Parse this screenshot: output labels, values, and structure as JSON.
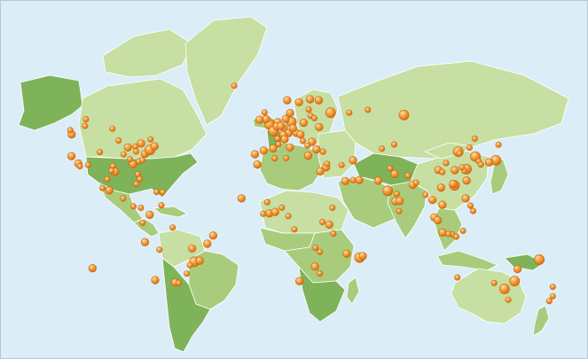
{
  "map": {
    "style": "world-mercator-choropleth",
    "colors": {
      "ocean": "#dbeef7",
      "land_light": "#c7dfa2",
      "land_mid": "#a8cc7c",
      "land_dark": "#7fb35a",
      "border": "#ffffff",
      "marker_fill": "#f29a2e",
      "marker_highlight": "#fde0b5",
      "marker_stroke": "#c8620f"
    },
    "regions": [
      {
        "id": "alaska",
        "shade": "land_dark"
      },
      {
        "id": "canada",
        "shade": "land_light"
      },
      {
        "id": "arctic-islands",
        "shade": "land_light"
      },
      {
        "id": "usa",
        "shade": "land_dark"
      },
      {
        "id": "mexico",
        "shade": "land_mid"
      },
      {
        "id": "central-america",
        "shade": "land_mid"
      },
      {
        "id": "caribbean",
        "shade": "land_mid"
      },
      {
        "id": "greenland",
        "shade": "land_light"
      },
      {
        "id": "iceland",
        "shade": "land_mid"
      },
      {
        "id": "south-america-north",
        "shade": "land_light"
      },
      {
        "id": "brazil",
        "shade": "land_mid"
      },
      {
        "id": "south-america-south",
        "shade": "land_dark"
      },
      {
        "id": "europe-west",
        "shade": "land_mid"
      },
      {
        "id": "uk",
        "shade": "land_dark"
      },
      {
        "id": "scandinavia",
        "shade": "land_light"
      },
      {
        "id": "eastern-europe",
        "shade": "land_light"
      },
      {
        "id": "russia",
        "shade": "land_light"
      },
      {
        "id": "north-africa",
        "shade": "land_light"
      },
      {
        "id": "west-africa",
        "shade": "land_mid"
      },
      {
        "id": "central-africa",
        "shade": "land_mid"
      },
      {
        "id": "southern-africa",
        "shade": "land_dark"
      },
      {
        "id": "madagascar",
        "shade": "land_mid"
      },
      {
        "id": "middle-east",
        "shade": "land_mid"
      },
      {
        "id": "central-asia",
        "shade": "land_dark"
      },
      {
        "id": "india",
        "shade": "land_mid"
      },
      {
        "id": "china",
        "shade": "land_light"
      },
      {
        "id": "mongolia",
        "shade": "land_light"
      },
      {
        "id": "southeast-asia",
        "shade": "land_mid"
      },
      {
        "id": "japan",
        "shade": "land_mid"
      },
      {
        "id": "indonesia",
        "shade": "land_mid"
      },
      {
        "id": "new-guinea",
        "shade": "land_dark"
      },
      {
        "id": "australia",
        "shade": "land_light"
      },
      {
        "id": "new-zealand",
        "shade": "land_mid"
      }
    ],
    "markers": [
      {
        "lon": -122.4,
        "lat": 37.8,
        "size": 2
      },
      {
        "lon": -118.2,
        "lat": 34.1,
        "size": 2
      },
      {
        "lon": -122.3,
        "lat": 47.6,
        "size": 2
      },
      {
        "lon": -117.2,
        "lat": 32.7,
        "size": 1
      },
      {
        "lon": -112.1,
        "lat": 33.4,
        "size": 1
      },
      {
        "lon": -104.9,
        "lat": 39.7,
        "size": 1
      },
      {
        "lon": -96.8,
        "lat": 32.8,
        "size": 1
      },
      {
        "lon": -95.4,
        "lat": 29.8,
        "size": 2
      },
      {
        "lon": -97.7,
        "lat": 30.3,
        "size": 1
      },
      {
        "lon": -93.3,
        "lat": 45.0,
        "size": 1
      },
      {
        "lon": -87.6,
        "lat": 41.9,
        "size": 2
      },
      {
        "lon": -90.2,
        "lat": 38.6,
        "size": 1
      },
      {
        "lon": -84.4,
        "lat": 33.7,
        "size": 2
      },
      {
        "lon": -81.4,
        "lat": 28.5,
        "size": 1
      },
      {
        "lon": -80.2,
        "lat": 25.8,
        "size": 1
      },
      {
        "lon": -77.0,
        "lat": 38.9,
        "size": 2
      },
      {
        "lon": -75.2,
        "lat": 40.0,
        "size": 1
      },
      {
        "lon": -74.0,
        "lat": 40.7,
        "size": 3
      },
      {
        "lon": -71.1,
        "lat": 42.4,
        "size": 2
      },
      {
        "lon": -79.4,
        "lat": 43.7,
        "size": 2
      },
      {
        "lon": -73.6,
        "lat": 45.5,
        "size": 1
      },
      {
        "lon": -83.0,
        "lat": 42.3,
        "size": 1
      },
      {
        "lon": -86.2,
        "lat": 36.2,
        "size": 1
      },
      {
        "lon": -80.8,
        "lat": 35.2,
        "size": 1
      },
      {
        "lon": -78.6,
        "lat": 35.8,
        "size": 1
      },
      {
        "lon": -82.5,
        "lat": 40.0,
        "size": 1
      },
      {
        "lon": -123.1,
        "lat": 49.3,
        "size": 1
      },
      {
        "lon": -114.1,
        "lat": 51.0,
        "size": 1
      },
      {
        "lon": -113.5,
        "lat": 53.5,
        "size": 1
      },
      {
        "lon": -97.1,
        "lat": 49.9,
        "size": 1
      },
      {
        "lon": -99.1,
        "lat": 19.4,
        "size": 2
      },
      {
        "lon": -103.3,
        "lat": 20.7,
        "size": 1
      },
      {
        "lon": -100.3,
        "lat": 25.7,
        "size": 1
      },
      {
        "lon": -90.5,
        "lat": 14.6,
        "size": 1
      },
      {
        "lon": -84.1,
        "lat": 9.9,
        "size": 1
      },
      {
        "lon": -79.5,
        "lat": 9.0,
        "size": 1
      },
      {
        "lon": -82.4,
        "lat": 23.1,
        "size": 1
      },
      {
        "lon": -66.1,
        "lat": 18.4,
        "size": 1
      },
      {
        "lon": -69.9,
        "lat": 18.5,
        "size": 1
      },
      {
        "lon": -74.1,
        "lat": 4.7,
        "size": 2
      },
      {
        "lon": -66.9,
        "lat": 10.5,
        "size": 1
      },
      {
        "lon": -78.5,
        "lat": -0.2,
        "size": 1
      },
      {
        "lon": -77.0,
        "lat": -12.0,
        "size": 2
      },
      {
        "lon": -68.1,
        "lat": -16.5,
        "size": 1
      },
      {
        "lon": -70.7,
        "lat": -33.4,
        "size": 2
      },
      {
        "lon": -58.4,
        "lat": -34.6,
        "size": 2
      },
      {
        "lon": -56.2,
        "lat": -34.9,
        "size": 1
      },
      {
        "lon": -46.6,
        "lat": -23.5,
        "size": 3
      },
      {
        "lon": -43.2,
        "lat": -22.9,
        "size": 2
      },
      {
        "lon": -47.9,
        "lat": -15.8,
        "size": 2
      },
      {
        "lon": -38.5,
        "lat": -13.0,
        "size": 2
      },
      {
        "lon": -34.9,
        "lat": -8.0,
        "size": 2
      },
      {
        "lon": -49.3,
        "lat": -25.4,
        "size": 1
      },
      {
        "lon": -51.2,
        "lat": -30.0,
        "size": 1
      },
      {
        "lon": -60.0,
        "lat": -3.1,
        "size": 1
      },
      {
        "lon": -109.4,
        "lat": -27.1,
        "size": 2
      },
      {
        "lon": -0.1,
        "lat": 51.5,
        "size": 3
      },
      {
        "lon": -2.2,
        "lat": 53.5,
        "size": 2
      },
      {
        "lon": -3.2,
        "lat": 55.9,
        "size": 1
      },
      {
        "lon": -6.3,
        "lat": 53.3,
        "size": 2
      },
      {
        "lon": 2.35,
        "lat": 48.9,
        "size": 3
      },
      {
        "lon": 4.9,
        "lat": 52.4,
        "size": 2
      },
      {
        "lon": 4.4,
        "lat": 50.8,
        "size": 2
      },
      {
        "lon": 8.7,
        "lat": 50.1,
        "size": 2
      },
      {
        "lon": 13.4,
        "lat": 52.5,
        "size": 3
      },
      {
        "lon": 11.6,
        "lat": 48.1,
        "size": 2
      },
      {
        "lon": 9.9,
        "lat": 53.6,
        "size": 2
      },
      {
        "lon": 6.9,
        "lat": 50.9,
        "size": 2
      },
      {
        "lon": 8.5,
        "lat": 47.4,
        "size": 2
      },
      {
        "lon": 16.4,
        "lat": 48.2,
        "size": 2
      },
      {
        "lon": 14.4,
        "lat": 50.1,
        "size": 2
      },
      {
        "lon": 21.0,
        "lat": 52.2,
        "size": 2
      },
      {
        "lon": 19.0,
        "lat": 47.5,
        "size": 2
      },
      {
        "lon": 12.5,
        "lat": 41.9,
        "size": 2
      },
      {
        "lon": 9.2,
        "lat": 45.5,
        "size": 2
      },
      {
        "lon": -3.7,
        "lat": 40.4,
        "size": 2
      },
      {
        "lon": 2.2,
        "lat": 41.4,
        "size": 2
      },
      {
        "lon": -9.1,
        "lat": 38.7,
        "size": 2
      },
      {
        "lon": 5.4,
        "lat": 43.3,
        "size": 1
      },
      {
        "lon": 4.8,
        "lat": 45.8,
        "size": 1
      },
      {
        "lon": 12.6,
        "lat": 55.7,
        "size": 2
      },
      {
        "lon": 18.1,
        "lat": 59.3,
        "size": 2
      },
      {
        "lon": 10.8,
        "lat": 59.9,
        "size": 2
      },
      {
        "lon": 24.9,
        "lat": 60.2,
        "size": 2
      },
      {
        "lon": 24.1,
        "lat": 56.9,
        "size": 1
      },
      {
        "lon": 25.3,
        "lat": 54.7,
        "size": 1
      },
      {
        "lon": 30.5,
        "lat": 50.5,
        "size": 2
      },
      {
        "lon": 26.1,
        "lat": 44.4,
        "size": 2
      },
      {
        "lon": 23.3,
        "lat": 42.7,
        "size": 1
      },
      {
        "lon": 20.5,
        "lat": 44.8,
        "size": 1
      },
      {
        "lon": 23.7,
        "lat": 38.0,
        "size": 2
      },
      {
        "lon": 28.9,
        "lat": 41.0,
        "size": 2
      },
      {
        "lon": 32.9,
        "lat": 39.9,
        "size": 1
      },
      {
        "lon": 37.6,
        "lat": 55.8,
        "size": 3
      },
      {
        "lon": 30.3,
        "lat": 59.9,
        "size": 2
      },
      {
        "lon": 27.6,
        "lat": 53.9,
        "size": 1
      },
      {
        "lon": 49.1,
        "lat": 55.8,
        "size": 1
      },
      {
        "lon": 60.6,
        "lat": 56.8,
        "size": 1
      },
      {
        "lon": 82.9,
        "lat": 55.0,
        "size": 3
      },
      {
        "lon": -21.9,
        "lat": 64.1,
        "size": 1
      },
      {
        "lon": 34.8,
        "lat": 32.1,
        "size": 2
      },
      {
        "lon": 35.5,
        "lat": 33.9,
        "size": 1
      },
      {
        "lon": 44.4,
        "lat": 33.3,
        "size": 1
      },
      {
        "lon": 46.7,
        "lat": 24.7,
        "size": 2
      },
      {
        "lon": 55.3,
        "lat": 25.3,
        "size": 2
      },
      {
        "lon": 51.4,
        "lat": 35.7,
        "size": 2
      },
      {
        "lon": 51.5,
        "lat": 25.3,
        "size": 1
      },
      {
        "lon": 31.2,
        "lat": 30.0,
        "size": 2
      },
      {
        "lon": 10.2,
        "lat": 36.8,
        "size": 1
      },
      {
        "lon": 3.1,
        "lat": 36.7,
        "size": 1
      },
      {
        "lon": -7.6,
        "lat": 33.6,
        "size": 2
      },
      {
        "lon": -17.4,
        "lat": 14.7,
        "size": 2
      },
      {
        "lon": -0.2,
        "lat": 5.6,
        "size": 2
      },
      {
        "lon": 3.4,
        "lat": 6.5,
        "size": 2
      },
      {
        "lon": -4.0,
        "lat": 5.3,
        "size": 1
      },
      {
        "lon": -1.5,
        "lat": 12.4,
        "size": 1
      },
      {
        "lon": 7.5,
        "lat": 9.1,
        "size": 1
      },
      {
        "lon": 11.5,
        "lat": 3.9,
        "size": 1
      },
      {
        "lon": 15.3,
        "lat": -4.3,
        "size": 1
      },
      {
        "lon": 36.8,
        "lat": -1.3,
        "size": 2
      },
      {
        "lon": 38.7,
        "lat": 9.0,
        "size": 1
      },
      {
        "lon": 32.6,
        "lat": 0.3,
        "size": 1
      },
      {
        "lon": 39.3,
        "lat": -6.8,
        "size": 1
      },
      {
        "lon": 28.3,
        "lat": -15.4,
        "size": 1
      },
      {
        "lon": 31.0,
        "lat": -17.8,
        "size": 1
      },
      {
        "lon": 28.0,
        "lat": -26.2,
        "size": 2
      },
      {
        "lon": 18.4,
        "lat": -33.9,
        "size": 2
      },
      {
        "lon": 31.0,
        "lat": -29.9,
        "size": 1
      },
      {
        "lon": 47.5,
        "lat": -18.9,
        "size": 2
      },
      {
        "lon": 55.5,
        "lat": -21.1,
        "size": 3
      },
      {
        "lon": 57.5,
        "lat": -20.2,
        "size": 2
      },
      {
        "lon": 72.9,
        "lat": 19.1,
        "size": 3
      },
      {
        "lon": 77.2,
        "lat": 28.6,
        "size": 2
      },
      {
        "lon": 77.6,
        "lat": 12.97,
        "size": 2
      },
      {
        "lon": 80.3,
        "lat": 13.1,
        "size": 2
      },
      {
        "lon": 88.4,
        "lat": 22.6,
        "size": 2
      },
      {
        "lon": 78.5,
        "lat": 17.4,
        "size": 1
      },
      {
        "lon": 67.0,
        "lat": 24.9,
        "size": 2
      },
      {
        "lon": 74.3,
        "lat": 31.5,
        "size": 1
      },
      {
        "lon": 79.9,
        "lat": 6.9,
        "size": 1
      },
      {
        "lon": 90.4,
        "lat": 23.8,
        "size": 1
      },
      {
        "lon": 85.3,
        "lat": 27.7,
        "size": 1
      },
      {
        "lon": 69.3,
        "lat": 41.3,
        "size": 1
      },
      {
        "lon": 76.9,
        "lat": 43.2,
        "size": 1
      },
      {
        "lon": 116.4,
        "lat": 39.9,
        "size": 3
      },
      {
        "lon": 121.5,
        "lat": 31.2,
        "size": 3
      },
      {
        "lon": 114.1,
        "lat": 22.3,
        "size": 3
      },
      {
        "lon": 113.3,
        "lat": 23.1,
        "size": 2
      },
      {
        "lon": 104.1,
        "lat": 30.7,
        "size": 2
      },
      {
        "lon": 108.9,
        "lat": 34.3,
        "size": 1
      },
      {
        "lon": 120.2,
        "lat": 30.3,
        "size": 1
      },
      {
        "lon": 118.8,
        "lat": 32.1,
        "size": 1
      },
      {
        "lon": 117.2,
        "lat": 39.1,
        "size": 1
      },
      {
        "lon": 123.4,
        "lat": 41.8,
        "size": 1
      },
      {
        "lon": 114.3,
        "lat": 30.6,
        "size": 2
      },
      {
        "lon": 106.6,
        "lat": 29.6,
        "size": 1
      },
      {
        "lon": 126.6,
        "lat": 45.8,
        "size": 1
      },
      {
        "lon": 121.6,
        "lat": 25.0,
        "size": 2
      },
      {
        "lon": 126.98,
        "lat": 37.57,
        "size": 3
      },
      {
        "lon": 129.1,
        "lat": 35.2,
        "size": 1
      },
      {
        "lon": 139.7,
        "lat": 35.7,
        "size": 3
      },
      {
        "lon": 135.5,
        "lat": 34.7,
        "size": 2
      },
      {
        "lon": 130.4,
        "lat": 33.6,
        "size": 1
      },
      {
        "lon": 141.3,
        "lat": 43.1,
        "size": 1
      },
      {
        "lon": 100.5,
        "lat": 13.75,
        "size": 2
      },
      {
        "lon": 105.8,
        "lat": 21.0,
        "size": 2
      },
      {
        "lon": 106.7,
        "lat": 10.8,
        "size": 2
      },
      {
        "lon": 96.2,
        "lat": 16.8,
        "size": 1
      },
      {
        "lon": 101.7,
        "lat": 3.1,
        "size": 2
      },
      {
        "lon": 103.8,
        "lat": 1.35,
        "size": 2
      },
      {
        "lon": 106.8,
        "lat": -6.2,
        "size": 2
      },
      {
        "lon": 112.7,
        "lat": -7.3,
        "size": 1
      },
      {
        "lon": 115.2,
        "lat": -8.7,
        "size": 1
      },
      {
        "lon": 121.0,
        "lat": 14.6,
        "size": 2
      },
      {
        "lon": 124.0,
        "lat": 10.3,
        "size": 1
      },
      {
        "lon": 125.6,
        "lat": 7.1,
        "size": 1
      },
      {
        "lon": 119.4,
        "lat": -5.1,
        "size": 1
      },
      {
        "lon": 110.4,
        "lat": -7.0,
        "size": 1
      },
      {
        "lon": 151.2,
        "lat": -33.9,
        "size": 3
      },
      {
        "lon": 145.0,
        "lat": -37.8,
        "size": 3
      },
      {
        "lon": 153.0,
        "lat": -27.5,
        "size": 2
      },
      {
        "lon": 115.9,
        "lat": -32.0,
        "size": 1
      },
      {
        "lon": 138.6,
        "lat": -34.9,
        "size": 1
      },
      {
        "lon": 147.3,
        "lat": -42.9,
        "size": 1
      },
      {
        "lon": 166.5,
        "lat": -22.3,
        "size": 3
      },
      {
        "lon": 174.8,
        "lat": -36.8,
        "size": 1
      },
      {
        "lon": 174.8,
        "lat": -41.3,
        "size": 1
      },
      {
        "lon": 172.6,
        "lat": -43.5,
        "size": 1
      }
    ]
  }
}
